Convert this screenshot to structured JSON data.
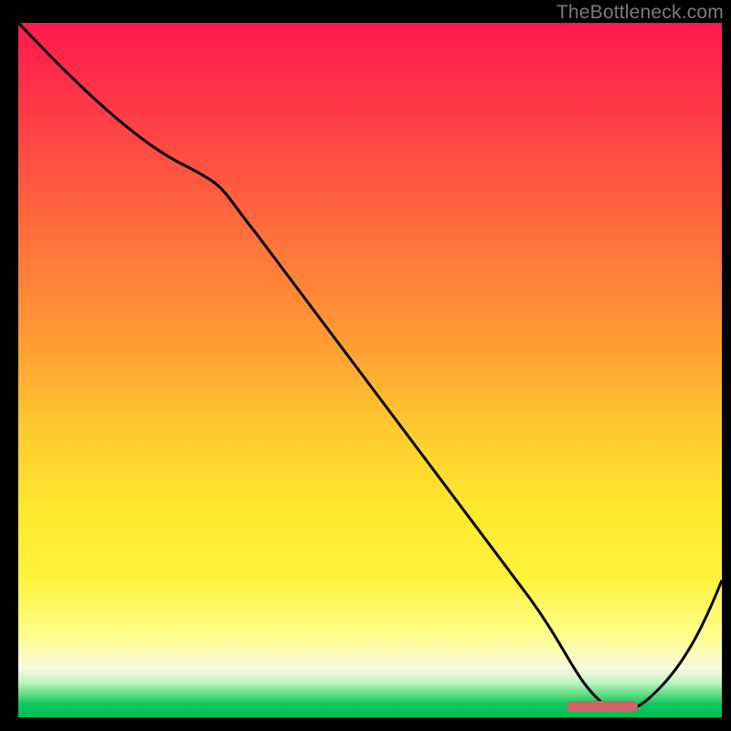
{
  "watermark": "TheBottleneck.com",
  "chart_data": {
    "type": "line",
    "title": "",
    "xlabel": "",
    "ylabel": "",
    "xlim": [
      0,
      100
    ],
    "ylim": [
      0,
      100
    ],
    "grid": false,
    "legend": false,
    "series": [
      {
        "name": "curve",
        "x": [
          0,
          6,
          23,
          28,
          35,
          45,
          55,
          65,
          74,
          78,
          82,
          86,
          90,
          100
        ],
        "values": [
          100,
          94,
          80,
          75,
          66,
          53,
          40,
          27,
          15,
          9,
          4,
          2,
          4,
          20
        ]
      }
    ],
    "optimum_marker": {
      "x_start": 78,
      "x_end": 88,
      "y": 1.5,
      "color": "#cf6367"
    },
    "gradient_stops": [
      {
        "pos": 0,
        "color": "#ff1a4d"
      },
      {
        "pos": 46,
        "color": "#ff9c33"
      },
      {
        "pos": 70,
        "color": "#ffe82f"
      },
      {
        "pos": 93,
        "color": "#f7fae0"
      },
      {
        "pos": 100,
        "color": "#00be54"
      }
    ]
  }
}
